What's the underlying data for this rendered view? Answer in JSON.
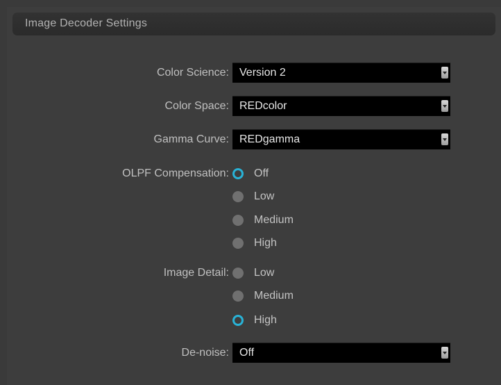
{
  "panel": {
    "title": "Image Decoder Settings"
  },
  "fields": {
    "color_science": {
      "label": "Color Science:",
      "value": "Version 2"
    },
    "color_space": {
      "label": "Color Space:",
      "value": "REDcolor"
    },
    "gamma_curve": {
      "label": "Gamma Curve:",
      "value": "REDgamma"
    },
    "olpf": {
      "label": "OLPF Compensation:",
      "options": [
        "Off",
        "Low",
        "Medium",
        "High"
      ],
      "selected": "Off"
    },
    "image_detail": {
      "label": "Image Detail:",
      "options": [
        "Low",
        "Medium",
        "High"
      ],
      "selected": "High"
    },
    "denoise": {
      "label": "De-noise:",
      "value": "Off"
    }
  },
  "colors": {
    "accent": "#29b2d6",
    "panel_bg": "#3d3d3d",
    "dropdown_bg": "#000000"
  }
}
